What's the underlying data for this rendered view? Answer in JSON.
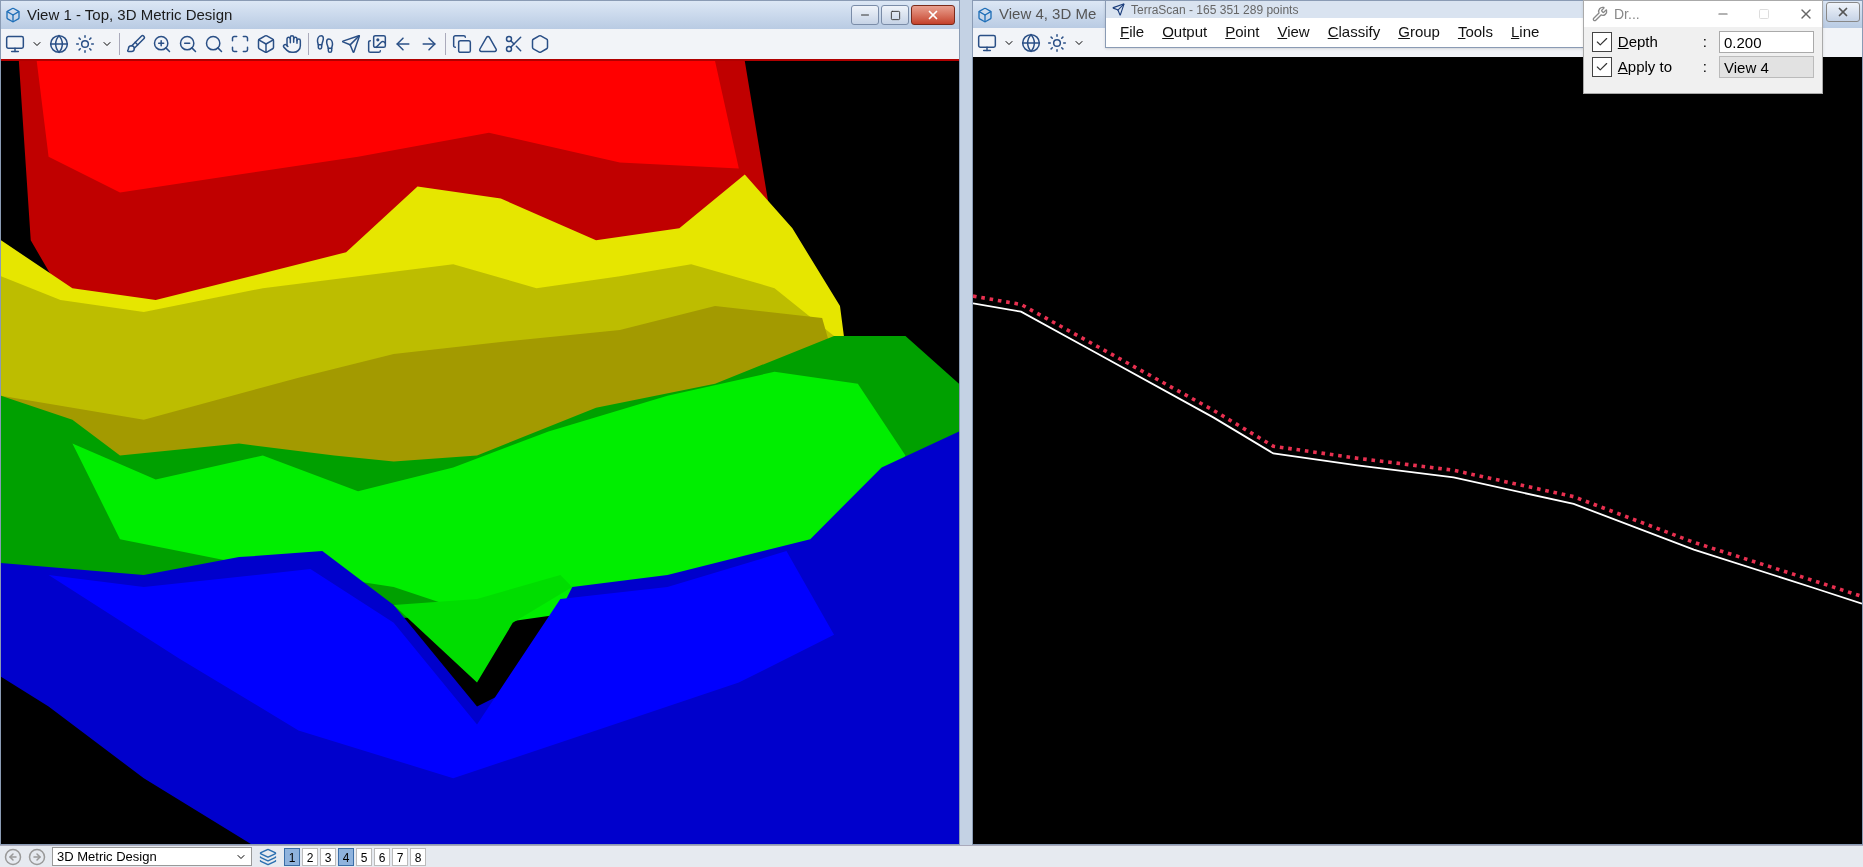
{
  "view_left": {
    "title": "View 1 - Top, 3D Metric Design"
  },
  "view_right": {
    "title": "View 4, 3D Me"
  },
  "terrascan": {
    "title": "TerraScan - 165 351 289 points",
    "menu": [
      "File",
      "Output",
      "Point",
      "View",
      "Classify",
      "Group",
      "Tools",
      "Line"
    ]
  },
  "dialog": {
    "title": "Dr...",
    "fields": [
      {
        "label": "Depth",
        "separator": ":",
        "checked": true,
        "value": "0.200",
        "kind": "input"
      },
      {
        "label": "Apply to",
        "separator": ":",
        "checked": true,
        "value": "View 4",
        "kind": "select"
      }
    ]
  },
  "bottom_bar": {
    "design": "3D Metric Design",
    "views": [
      {
        "label": "1",
        "selected": true
      },
      {
        "label": "2",
        "selected": false
      },
      {
        "label": "3",
        "selected": false
      },
      {
        "label": "4",
        "selected": true
      },
      {
        "label": "5",
        "selected": false
      },
      {
        "label": "6",
        "selected": false
      },
      {
        "label": "7",
        "selected": false
      },
      {
        "label": "8",
        "selected": false
      }
    ]
  }
}
